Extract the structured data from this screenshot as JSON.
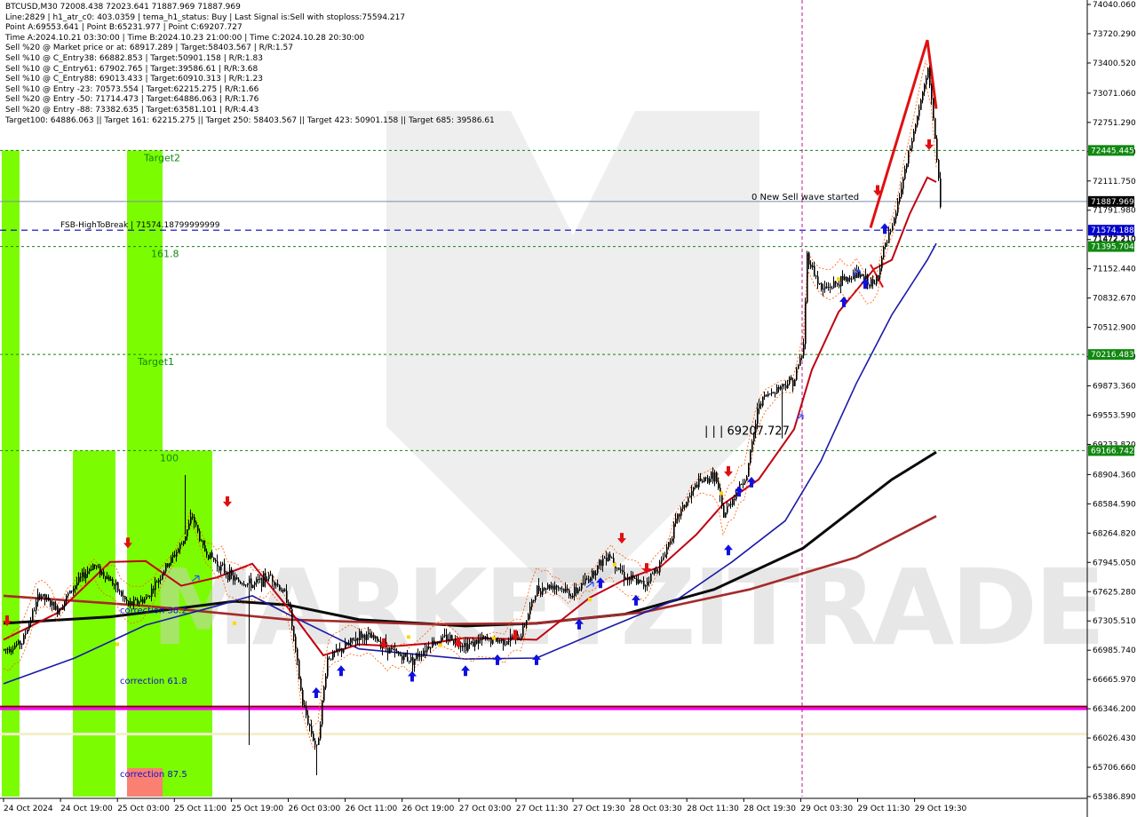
{
  "header": {
    "lines": [
      "BTCUSD,M30  72008.438 72023.641 71887.969 71887.969",
      "Line:2829  |  h1_atr_c0: 403.0359  |  tema_h1_status: Buy  |  Last Signal is:Sell with stoploss:75594.217",
      "Point A:69553.641  |  Point B:65231.977  |  Point C:69207.727",
      "Time A:2024.10.21 03:30:00  |  Time B:2024.10.23 21:00:00  |  Time C:2024.10.28 20:30:00",
      "Sell %20 @ Market price or at: 68917.289  |  Target:58403.567  |  R/R:1.57",
      "Sell %10 @ C_Entry38: 66882.853  |  Target:50901.158  |  R/R:1.83",
      "Sell %10 @ C_Entry61: 67902.765  |  Target:39586.61  |  R/R:3.68",
      "Sell %10 @ C_Entry88: 69013.433  |  Target:60910.313  |  R/R:1.23",
      "Sell %10 @ Entry -23: 70573.554  |  Target:62215.275  |  R/R:1.66",
      "Sell %20 @ Entry -50: 71714.473  |  Target:64886.063  |  R/R:1.76",
      "Sell %20 @ Entry -88: 73382.635  |  Target:63581.101  |  R/R:4.43",
      "Target100: 64886.063  ||  Target 161: 62215.275  ||  Target 250: 58403.567  ||  Target 423: 50901.158  ||  Target 685: 39586.61"
    ]
  },
  "chart_data": {
    "type": "candlestick",
    "symbol": "BTCUSD",
    "timeframe": "M30",
    "ylim": [
      65386.89,
      74040.06
    ],
    "y_ticks": [
      "74040.060",
      "73720.290",
      "73400.520",
      "73071.060",
      "72751.290",
      "72431.520",
      "72111.750",
      "71791.980",
      "71472.210",
      "71152.440",
      "70832.670",
      "70512.900",
      "70193.130",
      "69873.360",
      "69553.590",
      "69233.820",
      "68904.360",
      "68584.590",
      "68264.820",
      "67945.050",
      "67625.280",
      "67305.510",
      "66985.740",
      "66665.970",
      "66346.200",
      "66026.430",
      "65706.660",
      "65386.890"
    ],
    "x_labels": [
      "24 Oct 2024",
      "24 Oct 19:00",
      "25 Oct 03:00",
      "25 Oct 11:00",
      "25 Oct 19:00",
      "26 Oct 03:00",
      "26 Oct 11:00",
      "26 Oct 19:00",
      "27 Oct 03:00",
      "27 Oct 11:30",
      "27 Oct 19:30",
      "28 Oct 03:30",
      "28 Oct 11:30",
      "28 Oct 19:30",
      "29 Oct 03:30",
      "29 Oct 11:30",
      "29 Oct 19:30"
    ],
    "price_key_points": [
      [
        0,
        66990
      ],
      [
        10,
        67070
      ],
      [
        20,
        67600
      ],
      [
        30,
        67420
      ],
      [
        40,
        67700
      ],
      [
        50,
        67920
      ],
      [
        60,
        67750
      ],
      [
        70,
        67480
      ],
      [
        80,
        67550
      ],
      [
        90,
        67860
      ],
      [
        100,
        68150
      ],
      [
        106,
        68450
      ],
      [
        112,
        68100
      ],
      [
        120,
        67930
      ],
      [
        130,
        67750
      ],
      [
        140,
        67700
      ],
      [
        150,
        67800
      ],
      [
        160,
        67540
      ],
      [
        168,
        66400
      ],
      [
        176,
        65900
      ],
      [
        182,
        66900
      ],
      [
        190,
        66990
      ],
      [
        200,
        67150
      ],
      [
        210,
        67100
      ],
      [
        220,
        66950
      ],
      [
        230,
        66880
      ],
      [
        240,
        67060
      ],
      [
        250,
        67130
      ],
      [
        260,
        67040
      ],
      [
        270,
        67100
      ],
      [
        280,
        67090
      ],
      [
        290,
        67120
      ],
      [
        300,
        67650
      ],
      [
        310,
        67700
      ],
      [
        320,
        67590
      ],
      [
        330,
        67800
      ],
      [
        340,
        68050
      ],
      [
        350,
        67780
      ],
      [
        360,
        67700
      ],
      [
        370,
        67950
      ],
      [
        380,
        68480
      ],
      [
        390,
        68800
      ],
      [
        400,
        68900
      ],
      [
        405,
        68450
      ],
      [
        410,
        68650
      ],
      [
        418,
        68900
      ],
      [
        425,
        69700
      ],
      [
        435,
        69850
      ],
      [
        445,
        69950
      ],
      [
        450,
        70300
      ],
      [
        452,
        71300
      ],
      [
        460,
        70920
      ],
      [
        470,
        71000
      ],
      [
        480,
        71100
      ],
      [
        490,
        70960
      ],
      [
        495,
        71350
      ],
      [
        500,
        71600
      ],
      [
        508,
        72300
      ],
      [
        515,
        72900
      ],
      [
        520,
        73300
      ],
      [
        522,
        73050
      ],
      [
        525,
        72300
      ],
      [
        527,
        71880
      ]
    ],
    "series": [
      {
        "name": "",
        "color": "#0a0a0a",
        "values": [
          [
            0,
            67280
          ],
          [
            60,
            67350
          ],
          [
            130,
            67520
          ],
          [
            160,
            67480
          ],
          [
            200,
            67320
          ],
          [
            260,
            67250
          ],
          [
            300,
            67280
          ],
          [
            350,
            67380
          ],
          [
            400,
            67650
          ],
          [
            450,
            68100
          ],
          [
            500,
            68850
          ],
          [
            525,
            69150
          ]
        ]
      },
      {
        "name": "",
        "color": "#a52a2a",
        "values": [
          [
            0,
            67580
          ],
          [
            80,
            67470
          ],
          [
            160,
            67320
          ],
          [
            240,
            67270
          ],
          [
            300,
            67280
          ],
          [
            360,
            67400
          ],
          [
            420,
            67650
          ],
          [
            480,
            68000
          ],
          [
            525,
            68450
          ]
        ]
      },
      {
        "name": "",
        "color": "#1a1aa8",
        "values": [
          [
            0,
            66620
          ],
          [
            40,
            66900
          ],
          [
            80,
            67260
          ],
          [
            120,
            67470
          ],
          [
            140,
            67580
          ],
          [
            160,
            67380
          ],
          [
            200,
            67000
          ],
          [
            260,
            66890
          ],
          [
            300,
            66900
          ],
          [
            340,
            67230
          ],
          [
            380,
            67550
          ],
          [
            410,
            67950
          ],
          [
            440,
            68400
          ],
          [
            460,
            69050
          ],
          [
            480,
            69900
          ],
          [
            500,
            70650
          ],
          [
            520,
            71250
          ],
          [
            525,
            71430
          ]
        ]
      },
      {
        "name": "",
        "color": "#c00010",
        "values": [
          [
            0,
            67100
          ],
          [
            30,
            67390
          ],
          [
            60,
            67950
          ],
          [
            80,
            67960
          ],
          [
            100,
            67690
          ],
          [
            120,
            67780
          ],
          [
            140,
            67930
          ],
          [
            160,
            67450
          ],
          [
            180,
            66930
          ],
          [
            200,
            67050
          ],
          [
            220,
            67030
          ],
          [
            240,
            67060
          ],
          [
            260,
            67120
          ],
          [
            300,
            67100
          ],
          [
            330,
            67560
          ],
          [
            350,
            67760
          ],
          [
            370,
            67900
          ],
          [
            390,
            68250
          ],
          [
            405,
            68580
          ],
          [
            425,
            68850
          ],
          [
            445,
            69400
          ],
          [
            455,
            70050
          ],
          [
            470,
            70680
          ],
          [
            490,
            71150
          ],
          [
            500,
            71250
          ],
          [
            510,
            71750
          ],
          [
            520,
            72150
          ],
          [
            525,
            72100
          ]
        ]
      }
    ]
  },
  "levels": {
    "target2": {
      "value": 72445.445,
      "label": "Target2",
      "tag": "72445.445"
    },
    "current": {
      "value": 71887.969,
      "tag": "71887.969",
      "text": "0 New Sell wave started"
    },
    "fsb": {
      "value": 71574.188,
      "label": "FSB-HighToBreak | 71574.18799999999",
      "tag": "71574.188"
    },
    "t1618": {
      "value": 71395.704,
      "label": "161.8",
      "tag": "71395.704",
      "over": "71472.210"
    },
    "target1": {
      "value": 70216.483,
      "label": "Target1",
      "tag": "70216.483"
    },
    "l100": {
      "value": 69166.742,
      "label": "100",
      "tag": "69166.742"
    },
    "magenta": {
      "value": 66346.2
    },
    "cream": {
      "value": 66070
    },
    "darkred": {
      "value": 66370
    }
  },
  "zone_labels": {
    "corr382": "correction 38.2",
    "corr618": "correction 61.8",
    "corr875": "correction 87.5",
    "point_c": "| | | 69207.727"
  },
  "watermark": "MARKETZITRADE",
  "colors": {
    "green_zone": "#7cfc00",
    "salmon_zone": "#fa8072",
    "level_green": "#118811",
    "fsb_blue": "#0000cc",
    "magenta": "#ff00ff",
    "vline": "#c0148c"
  }
}
